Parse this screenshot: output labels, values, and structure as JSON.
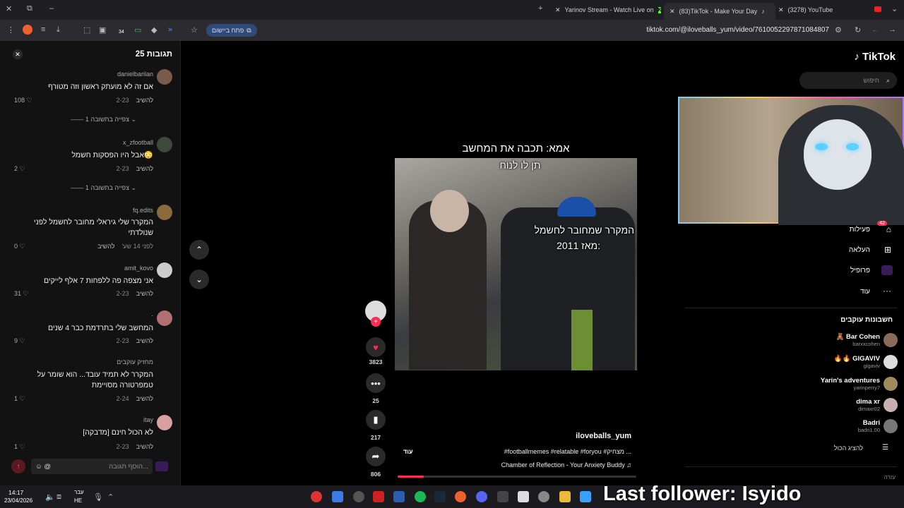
{
  "browser": {
    "tabs": [
      {
        "label": "Yarinov Stream - Watch Live on"
      },
      {
        "label": "(83)TikTok - Make Your Day"
      },
      {
        "label": "(3278) YouTube"
      }
    ],
    "address": "tiktok.com/@iloveballs_yum/video/7610052297871084807",
    "open_in_app": "פתח ביישום",
    "extension_badge": "34"
  },
  "comments": {
    "title": "תגובות 25",
    "items": [
      {
        "user": "danielbarilan",
        "text": "אם זה לא מועתק ראשון וזה מטורף",
        "date": "2-23",
        "reply": "להשיב",
        "likes": "108",
        "replies": "צפייה בתשובה 1"
      },
      {
        "user": "x_zfootball",
        "text": "אבל היו הפסקות חשמל😳",
        "date": "2-23",
        "reply": "להשיב",
        "likes": "2",
        "replies": "צפייה בתשובה 1"
      },
      {
        "user": "fq.edits",
        "text": "המקרר שלי גיראלי מחובר לחשמל לפני שנולדתי",
        "date": "לפני 14 שע'",
        "reply": "להשיב",
        "likes": "0"
      },
      {
        "user": "amit_kovo",
        "text": "אני מצפה פה ללפחות 7 אלף לייקים",
        "date": "2-23",
        "reply": "להשיב",
        "likes": "31"
      },
      {
        "user": ".",
        "text": "המחשב שלי בתרדמת כבר 4 שנים",
        "date": "2-23",
        "reply": "להשיב",
        "likes": "9"
      },
      {
        "user": "מחזיק עוקבים",
        "text": "המקרר לא תמיד עובד... הוא שומר על טמפרטורה מסויימת",
        "date": "2-24",
        "reply": "להשיב",
        "likes": "1"
      },
      {
        "user": "itay",
        "text": "[מדבקה] לא הכול חינם",
        "date": "2-23",
        "reply": "להשיב",
        "likes": "1"
      }
    ],
    "input_placeholder": "הוסף תגובה..."
  },
  "video": {
    "caption_top": "אמא: תכבה את המחשב",
    "caption_sub": "תן לו לנוח",
    "caption_mid_1": "המקרר שמחובר לחשמל",
    "caption_mid_2": "מאז 2011:",
    "likes": "3823",
    "comments": "25",
    "saves": "217",
    "shares": "806",
    "author": "iloveballs_yum",
    "hashtags": "#footballmemes #relatable #foryou #מצחיק ...",
    "more": "עוד",
    "music": "Chamber of Reflection - Your Anxiety Buddy"
  },
  "tiktok": {
    "logo": "TikTok",
    "search_placeholder": "חיפוש",
    "nav": [
      {
        "label": "פעילות",
        "icon": "inbox-icon"
      },
      {
        "label": "העלאה",
        "icon": "upload-icon"
      },
      {
        "label": "פרופיל",
        "icon": "profile-icon"
      },
      {
        "label": "עוד",
        "icon": "more-icon"
      }
    ],
    "activity_badge": "42",
    "following_title": "חשבונות עוקבים",
    "following": [
      {
        "name": "Bar Cohen",
        "handle": "barxxcohen"
      },
      {
        "name": "GIGAVIV",
        "handle": "gigaviv"
      },
      {
        "name": "Yarin's adventures",
        "handle": "yarinperry7"
      },
      {
        "name": "dima xr",
        "handle": "dimaxr02"
      },
      {
        "name": "Badri",
        "handle": "badri1.00"
      }
    ],
    "show_all": "להציג הכול",
    "footer": "עזרה"
  },
  "overlay": {
    "last_follower": "Last follower: Isyido"
  },
  "taskbar": {
    "time": "14:17",
    "date": "23/04/2026",
    "lang_1": "עבר",
    "lang_2": "HE"
  },
  "colors": {
    "accent": "#fe2c55",
    "dark_panel": "#121212"
  }
}
